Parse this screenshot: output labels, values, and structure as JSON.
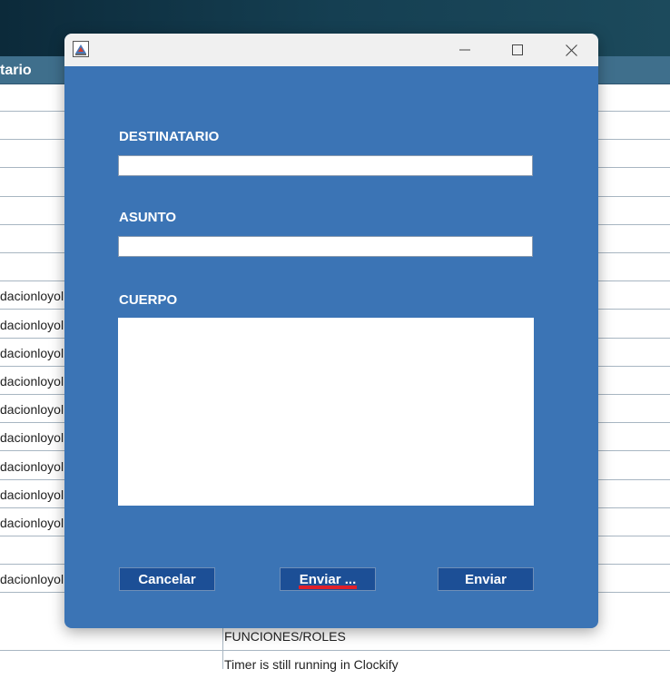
{
  "background_app": {
    "header_text": "tario",
    "rows": [
      {
        "cell": ""
      },
      {
        "cell": ""
      },
      {
        "cell": ""
      },
      {
        "cell": ""
      },
      {
        "cell": ""
      },
      {
        "cell": ""
      },
      {
        "cell": ""
      },
      {
        "cell": "dacionloyol"
      },
      {
        "cell": "dacionloyol"
      },
      {
        "cell": "dacionloyol"
      },
      {
        "cell": "dacionloyol"
      },
      {
        "cell": "dacionloyol"
      },
      {
        "cell": "dacionloyol"
      },
      {
        "cell": "dacionloyol"
      },
      {
        "cell": "dacionloyol"
      },
      {
        "cell": "dacionloyol"
      },
      {
        "cell": ""
      },
      {
        "cell": "dacionloyol"
      }
    ],
    "bottom_cells": [
      "FUNCIONES/ROLES",
      "Timer is still running in Clockify"
    ]
  },
  "dialog": {
    "title": "",
    "labels": {
      "destinatario": "DESTINATARIO",
      "asunto": "ASUNTO",
      "cuerpo": "CUERPO"
    },
    "inputs": {
      "destinatario_value": "",
      "asunto_value": "",
      "cuerpo_value": ""
    },
    "buttons": {
      "cancel": "Cancelar",
      "send_with_options": "Enviar ...",
      "send": "Enviar"
    }
  },
  "icons": {
    "app": "java-app-icon",
    "minimize": "minimize-icon",
    "maximize": "maximize-icon",
    "close": "close-icon"
  },
  "colors": {
    "dialog_bg": "#3b74b5",
    "button_bg": "#1c4f96",
    "titlebar_bg": "#f0f0f0",
    "focus_underline": "#e0202a"
  }
}
